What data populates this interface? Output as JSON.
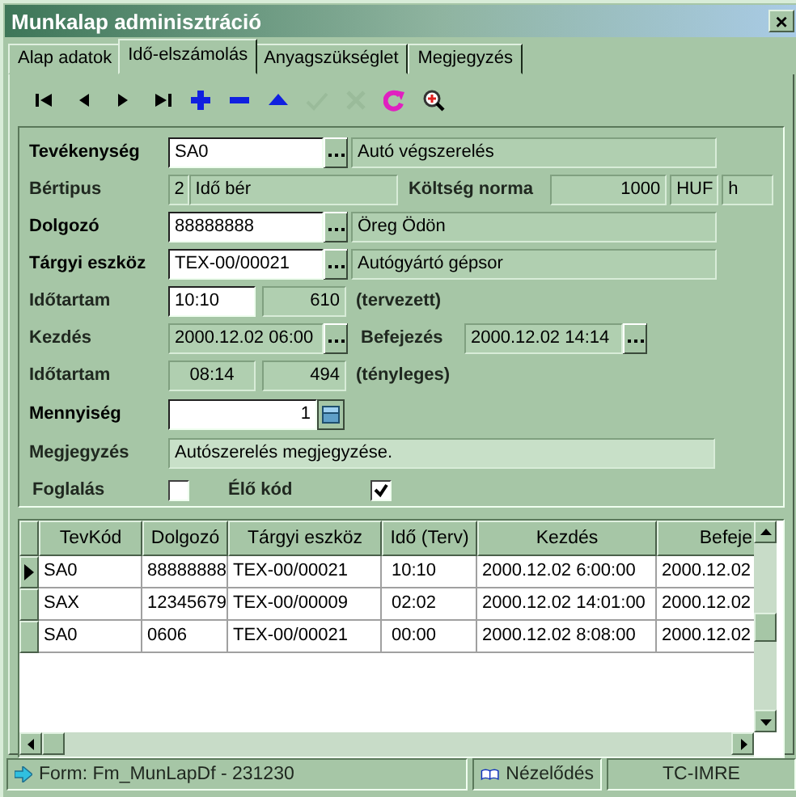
{
  "window": {
    "title": "Munkalap adminisztráció",
    "close": "×"
  },
  "tabs": [
    {
      "label": "Alap adatok",
      "selected": false
    },
    {
      "label": "Idő-elszámolás",
      "selected": true
    },
    {
      "label": "Anyagszükséglet",
      "selected": false
    },
    {
      "label": "Megjegyzés",
      "selected": false
    }
  ],
  "toolbar": [
    {
      "kind": "first",
      "disabled": false
    },
    {
      "kind": "prev",
      "disabled": false
    },
    {
      "kind": "next",
      "disabled": false
    },
    {
      "kind": "last",
      "disabled": false
    },
    {
      "kind": "add",
      "disabled": false
    },
    {
      "kind": "delete",
      "disabled": false
    },
    {
      "kind": "edit",
      "disabled": false
    },
    {
      "kind": "post",
      "disabled": true
    },
    {
      "kind": "cancel",
      "disabled": true
    },
    {
      "kind": "refresh",
      "disabled": false
    },
    {
      "kind": "zoom",
      "disabled": false
    }
  ],
  "form": {
    "activity": {
      "label": "Tevékenység",
      "code": "SA0",
      "description": "Autó végszerelés"
    },
    "wage_type": {
      "label": "Bértipus",
      "code": "2",
      "description": "Idő bér"
    },
    "cost_norm": {
      "label": "Költség norma",
      "value": "1000",
      "currency": "HUF",
      "unit": "h"
    },
    "worker": {
      "label": "Dolgozó",
      "code": "88888888",
      "description": "Öreg Ödön"
    },
    "asset": {
      "label": "Tárgyi eszköz",
      "code": "TEX-00/00021",
      "description": "Autógyártó gépsor"
    },
    "planned_duration": {
      "label": "Időtartam",
      "time": "10:10",
      "minutes": "610",
      "note": "(tervezett)"
    },
    "start": {
      "label": "Kezdés",
      "value": "2000.12.02 06:00"
    },
    "end": {
      "label": "Befejezés",
      "value": "2000.12.02 14:14"
    },
    "actual_duration": {
      "label": "Időtartam",
      "time": "08:14",
      "minutes": "494",
      "note": "(tényleges)"
    },
    "quantity": {
      "label": "Mennyiség",
      "value": "1"
    },
    "remark": {
      "label": "Megjegyzés",
      "value": "Autószerelés megjegyzése."
    },
    "booking": {
      "label": "Foglalás",
      "checked": false
    },
    "live_code": {
      "label": "Élő kód",
      "checked": true
    }
  },
  "table": {
    "columns": [
      "TevKód",
      "Dolgozó",
      "Tárgyi eszköz",
      "Idő (Terv)",
      "Kezdés",
      "Befeje"
    ],
    "rows": [
      {
        "selected": true,
        "cells": [
          "SA0",
          "88888888",
          "TEX-00/00021",
          "10:10",
          "2000.12.02 6:00:00",
          "2000.12.02"
        ]
      },
      {
        "selected": false,
        "cells": [
          "SAX",
          "12345679",
          "TEX-00/00009",
          "02:02",
          "2000.12.02 14:01:00",
          "2000.12.02"
        ]
      },
      {
        "selected": false,
        "cells": [
          "SA0",
          "0606",
          "TEX-00/00021",
          "00:00",
          "2000.12.02 8:08:00",
          "2000.12.02"
        ]
      }
    ]
  },
  "status_bar": {
    "form": "Form: Fm_MunLapDf - 231230",
    "mode": "Nézelődés",
    "user": "TC-IMRE"
  }
}
